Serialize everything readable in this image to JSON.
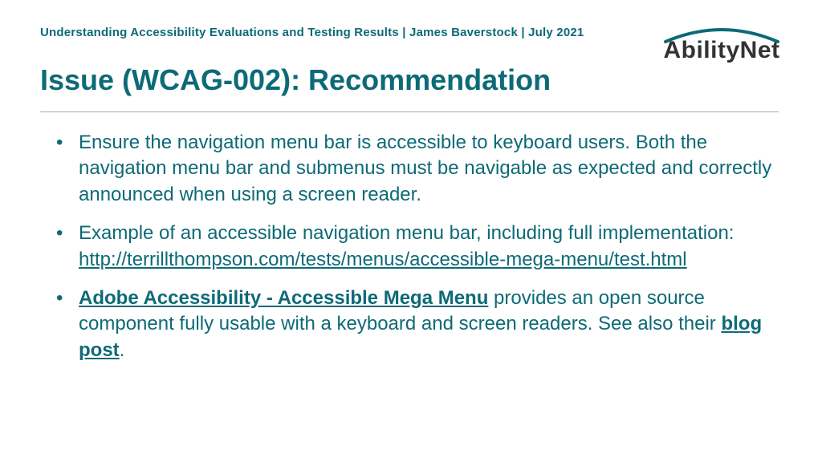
{
  "header": {
    "breadcrumb": "Understanding Accessibility Evaluations and Testing Results | James Baverstock | July 2021",
    "logo_text": "AbilityNet"
  },
  "title": "Issue (WCAG-002): Recommendation",
  "bullets": [
    {
      "text_before": "Ensure the navigation menu bar is accessible to keyboard users. Both the navigation menu bar and submenus must be navigable as expected and correctly announced when using a screen reader."
    },
    {
      "text_before": "Example of an accessible navigation menu bar, including full implementation: ",
      "link1_text": "http://terrillthompson.com/tests/menus/accessible-mega-menu/test.html"
    },
    {
      "link1_text": "Adobe Accessibility - Accessible Mega Menu",
      "text_mid": " provides an open source component fully usable with a keyboard and screen readers. See also their ",
      "link2_text": "blog post",
      "text_after": "."
    }
  ]
}
